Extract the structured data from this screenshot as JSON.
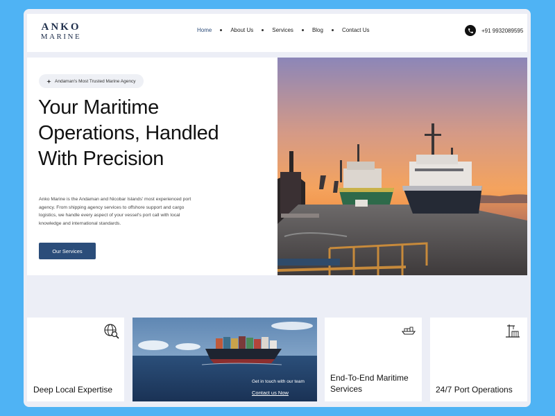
{
  "brand": {
    "line1": "ANKO",
    "line2": "MARINE"
  },
  "nav": {
    "items": [
      {
        "label": "Home",
        "active": true
      },
      {
        "label": "About Us"
      },
      {
        "label": "Services"
      },
      {
        "label": "Blog"
      },
      {
        "label": "Contact Us"
      }
    ]
  },
  "contact": {
    "phone": "+91 9932089595",
    "icon": "phone-icon"
  },
  "hero": {
    "badge": "Andaman's Most Trusted Marine Agency",
    "badge_icon": "star-icon",
    "title_line1": "Your Maritime",
    "title_line2": "Operations, Handled",
    "title_line3": "With Precision",
    "description": "Anko Marine is the Andaman and Nicobar Islands' most experienced port agency. From shipping agency services to offshore support and cargo logistics, we handle every aspect of your vessel's port call with local knowledge and international standards.",
    "cta": "Our Services"
  },
  "cards": [
    {
      "title": "Deep Local Expertise",
      "icon": "globe-search-icon"
    },
    {
      "caption": "Get in touch with our team",
      "link": "Contact us Now"
    },
    {
      "title": "End-To-End Maritime Services",
      "icon": "cargo-ship-icon"
    },
    {
      "title": "24/7 Port Operations",
      "icon": "port-crane-icon"
    }
  ],
  "colors": {
    "page_bg": "#4fb3f4",
    "frame_bg": "#eceef6",
    "accent": "#2b4d7a",
    "brand": "#1d2d4a"
  }
}
